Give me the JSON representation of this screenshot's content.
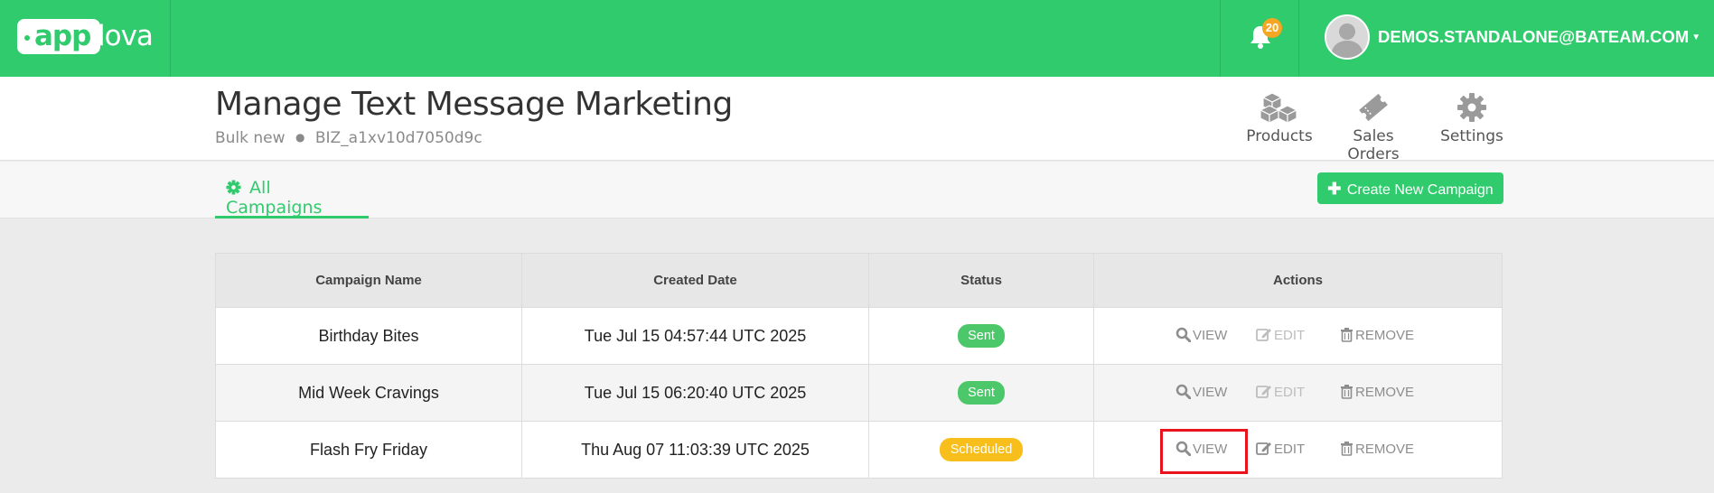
{
  "brand": {
    "logo_part1": "app",
    "logo_part2": "lova"
  },
  "topbar": {
    "notifications_count": "20",
    "user_email": "DEMOS.STANDALONE@BATEAM.COM"
  },
  "header": {
    "title": "Manage Text Message Marketing",
    "subtitle_left": "Bulk new",
    "subtitle_right": "BIZ_a1xv10d7050d9c",
    "nav": [
      {
        "label": "Products",
        "icon": "boxes-icon"
      },
      {
        "label": "Sales Orders",
        "icon": "ticket-icon"
      },
      {
        "label": "Settings",
        "icon": "gear-icon"
      }
    ]
  },
  "tabs": {
    "all_campaigns": "All Campaigns"
  },
  "create_button": "Create New Campaign",
  "table": {
    "headers": [
      "Campaign Name",
      "Created Date",
      "Status",
      "Actions"
    ],
    "rows": [
      {
        "name": "Birthday Bites",
        "created": "Tue Jul 15 04:57:44 UTC 2025",
        "status": "Sent",
        "view": "VIEW",
        "edit": "EDIT",
        "remove": "REMOVE"
      },
      {
        "name": "Mid Week Cravings",
        "created": "Tue Jul 15 06:20:40 UTC 2025",
        "status": "Sent",
        "view": "VIEW",
        "edit": "EDIT",
        "remove": "REMOVE"
      },
      {
        "name": "Flash Fry Friday",
        "created": "Thu Aug 07 11:03:39 UTC 2025",
        "status": "Scheduled",
        "view": "VIEW",
        "edit": "EDIT",
        "remove": "REMOVE"
      }
    ]
  },
  "colors": {
    "brand_green": "#2fcb6d",
    "status_sent": "#4cc86b",
    "status_scheduled": "#f8bf1c",
    "notification_badge": "#f5a623",
    "highlight": "#e8131c"
  }
}
